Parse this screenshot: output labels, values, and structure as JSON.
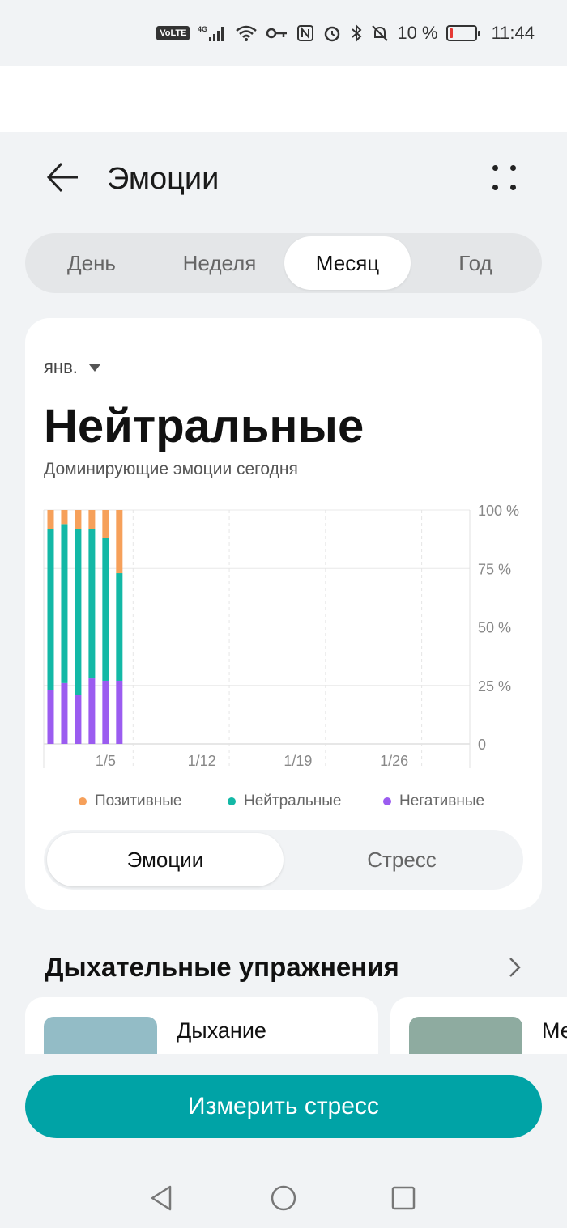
{
  "status_bar": {
    "volte": "VoLTE",
    "network": "4G",
    "battery_text": "10 %",
    "time": "11:44",
    "battery_level": 0.1,
    "icons": [
      "signal-icon",
      "wifi-icon",
      "key-icon",
      "nfc-icon",
      "alarm-icon",
      "bluetooth-icon",
      "mute-icon",
      "battery-icon"
    ]
  },
  "header": {
    "title": "Эмоции",
    "back_icon": "arrow-left-icon",
    "menu_icon": "more-dots-icon"
  },
  "period_tabs": [
    {
      "label": "День",
      "active": false
    },
    {
      "label": "Неделя",
      "active": false
    },
    {
      "label": "Месяц",
      "active": true
    },
    {
      "label": "Год",
      "active": false
    }
  ],
  "summary": {
    "month_selector": "янв.",
    "dominant": "Нейтральные",
    "subtitle": "Доминирующие эмоции сегодня"
  },
  "chart_data": {
    "type": "bar",
    "stacked": true,
    "x_tick_labels": [
      "1/5",
      "1/12",
      "1/19",
      "1/26"
    ],
    "y_tick_labels": [
      "100 %",
      "75 %",
      "50 %",
      "25 %",
      "0"
    ],
    "ylim": [
      0,
      100
    ],
    "categories": [
      "1/1",
      "1/2",
      "1/3",
      "1/4",
      "1/5",
      "1/6"
    ],
    "series": [
      {
        "name": "Негативные",
        "color": "#9b5cf0",
        "values": [
          23,
          26,
          21,
          28,
          27,
          27
        ]
      },
      {
        "name": "Нейтральные",
        "color": "#13b8a6",
        "values": [
          69,
          68,
          71,
          64,
          61,
          46
        ]
      },
      {
        "name": "Позитивные",
        "color": "#f6a05a",
        "values": [
          8,
          6,
          8,
          8,
          12,
          27
        ]
      }
    ],
    "grid": true,
    "days_in_month": 31,
    "y_axis_side": "right"
  },
  "legend": [
    {
      "label": "Позитивные",
      "color": "#f6a05a"
    },
    {
      "label": "Нейтральные",
      "color": "#13b8a6"
    },
    {
      "label": "Негативные",
      "color": "#9b5cf0"
    }
  ],
  "mode_toggle": [
    {
      "label": "Эмоции",
      "active": true
    },
    {
      "label": "Стресс",
      "active": false
    }
  ],
  "breathing": {
    "title": "Дыхательные упражнения",
    "chevron_icon": "chevron-right-icon",
    "cards": [
      {
        "title": "Дыхание",
        "image_color": "#93bcc6"
      },
      {
        "title": "Ме",
        "image_color": "#8eaba0"
      }
    ]
  },
  "cta": {
    "label": "Измерить стресс"
  },
  "nav": {
    "icons": [
      "nav-back-icon",
      "nav-home-icon",
      "nav-recents-icon"
    ]
  }
}
